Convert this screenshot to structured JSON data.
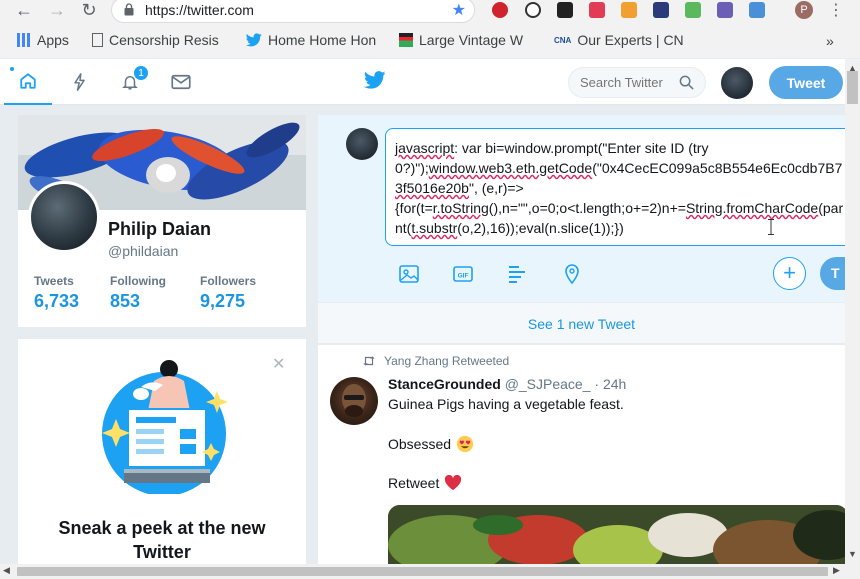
{
  "browser": {
    "url": "https://twitter.com",
    "bookmarks": [
      "Apps",
      "Censorship Resis",
      "Home Home Hon",
      "Large Vintage W",
      "Our Experts | CN"
    ],
    "bookmarks_more": "»",
    "profile_initial": "P"
  },
  "nav": {
    "notifications_count": "1",
    "search_placeholder": "Search Twitter",
    "tweet_button": "Tweet"
  },
  "profile": {
    "name": "Philip Daian",
    "handle": "@phildaian",
    "stats": [
      {
        "label": "Tweets",
        "value": "6,733"
      },
      {
        "label": "Following",
        "value": "853"
      },
      {
        "label": "Followers",
        "value": "9,275"
      }
    ]
  },
  "promo": {
    "title_line1": "Sneak a peek at the new",
    "title_line2": "Twitter"
  },
  "compose": {
    "line1a": "javascript",
    "line1b": ": var bi=window.prompt(\"Enter site ID (try",
    "line2a": "0?)\");",
    "line2b": "window.web3.eth.getCode",
    "line2c": "(\"0x4CecEC099a5c8B554e6Ec0cdb7B7",
    "line3a": "3f5016e20b",
    "line3b": "\", (e,r)=>",
    "line4a": "{for(t=",
    "line4b": "r.toString",
    "line4c": "(),n=\"\",o=0;o<t.length;o+=2)n+=",
    "line4d": "String.fromCharCode",
    "line4e": "(par",
    "line5a": "nt(",
    "line5b": "t.substr",
    "line5c": "(o,2),16));eval(n.slice(1));})",
    "send_partial": "T"
  },
  "timeline": {
    "new_tweets": "See 1 new Tweet",
    "retweeted_by": "Yang Zhang Retweeted",
    "tweet": {
      "name": "StanceGrounded",
      "handle": "@_SJPeace_",
      "time": "· 24h",
      "text1": "Guinea Pigs having a vegetable feast.",
      "text2": "Obsessed",
      "text3": "Retweet"
    }
  }
}
